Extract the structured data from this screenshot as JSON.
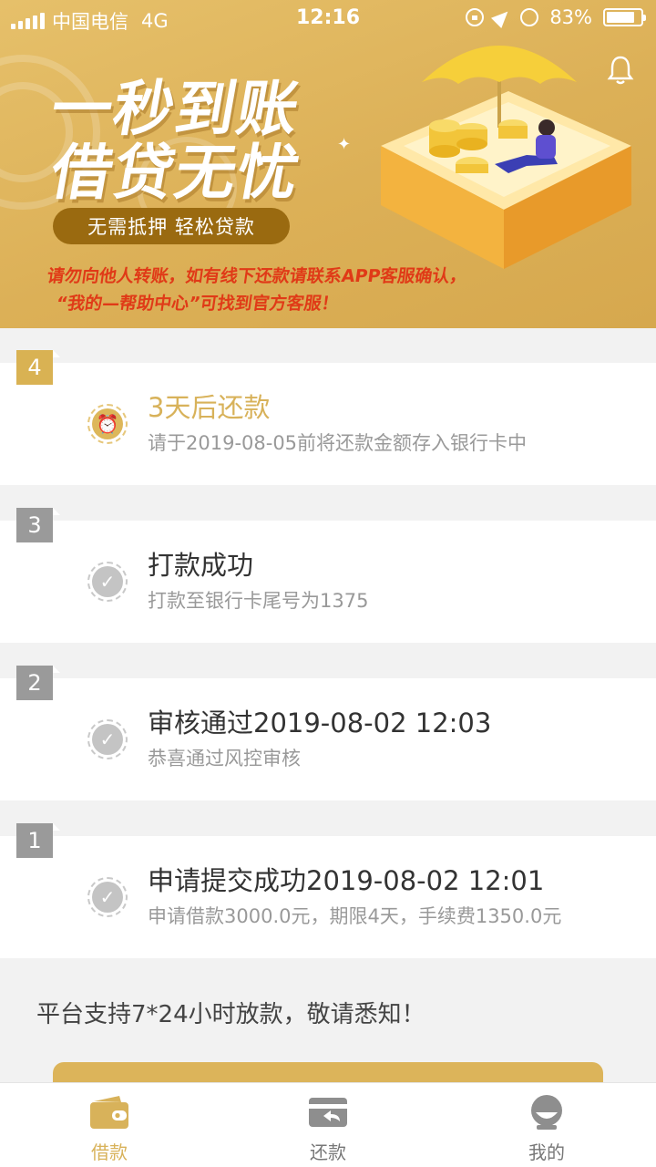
{
  "status_bar": {
    "carrier": "中国电信",
    "network": "4G",
    "time": "12:16",
    "battery": "83%",
    "battery_level": 0.83
  },
  "banner": {
    "title_line1": "一秒到账",
    "title_line2": "借贷无忧",
    "pill": "无需抵押  轻松贷款",
    "warning_line1": "请勿向他人转账，如有线下还款请联系APP客服确认，",
    "warning_line2": "“我的—帮助中心”可找到官方客服！"
  },
  "steps": [
    {
      "number": "4",
      "title": "3天后还款",
      "desc": "请于2019-08-05前将还款金额存入银行卡中",
      "state": "current"
    },
    {
      "number": "3",
      "title": "打款成功",
      "desc": "打款至银行卡尾号为1375",
      "state": "done"
    },
    {
      "number": "2",
      "title": "审核通过2019-08-02 12:03",
      "desc": "恭喜通过风控审核",
      "state": "done"
    },
    {
      "number": "1",
      "title": "申请提交成功2019-08-02 12:01",
      "desc": "申请借款3000.0元，期限4天，手续费1350.0元",
      "state": "done"
    }
  ],
  "notice": "平台支持7*24小时放款，敬请悉知！",
  "tabs": [
    {
      "label": "借款",
      "icon": "wallet-icon",
      "active": true
    },
    {
      "label": "还款",
      "icon": "repay-card-icon",
      "active": false
    },
    {
      "label": "我的",
      "icon": "profile-icon",
      "active": false
    }
  ],
  "colors": {
    "accent": "#d8b25a",
    "banner": "#dcb057",
    "warning": "#e03a17",
    "inactive": "#9a9a9a"
  }
}
